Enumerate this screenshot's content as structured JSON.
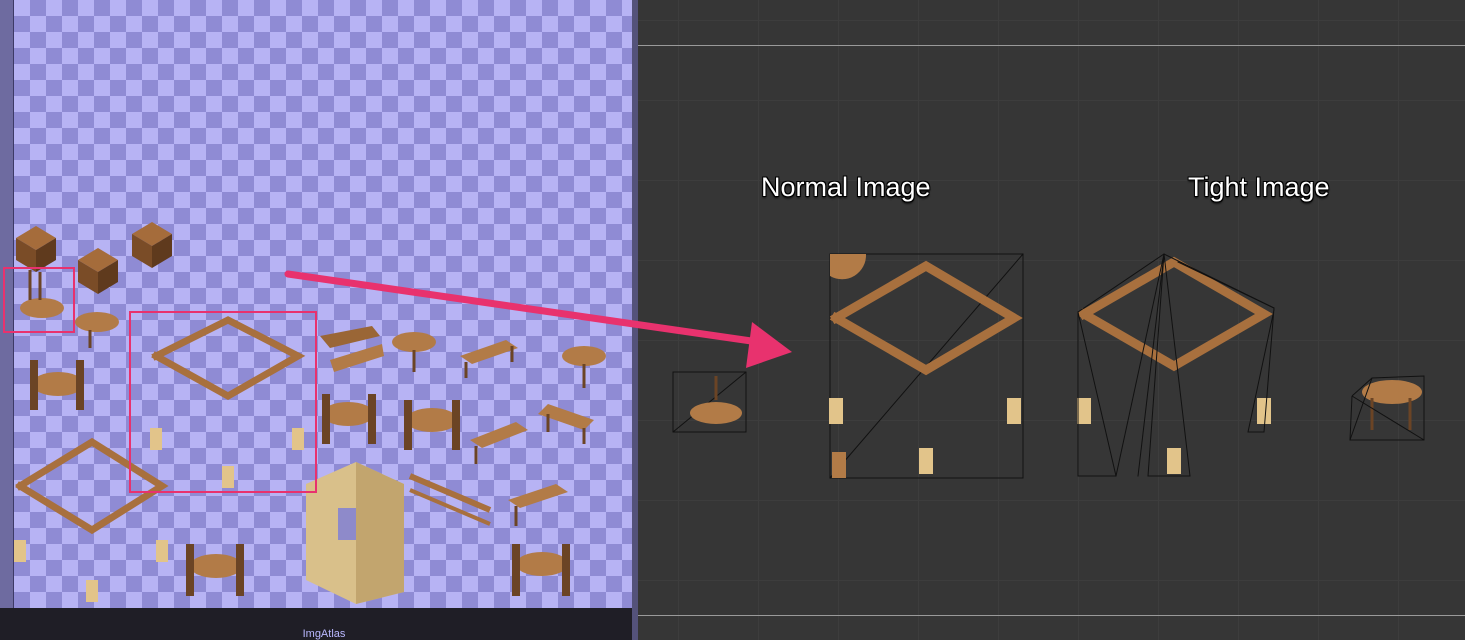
{
  "atlas": {
    "name": "ImgAtlas"
  },
  "scene": {
    "normal_caption": "Normal Image",
    "tight_caption": "Tight Image"
  },
  "colors": {
    "highlight": "#e8326e",
    "checker_light": "#b7b3f4",
    "checker_dark": "#8f8bd4",
    "wood": "#b07845",
    "wood_dark": "#7a4f2a",
    "stone": "#d9c08a",
    "scene_bg": "#363636"
  },
  "icons": {
    "arrow": "pointer-arrow-icon"
  }
}
